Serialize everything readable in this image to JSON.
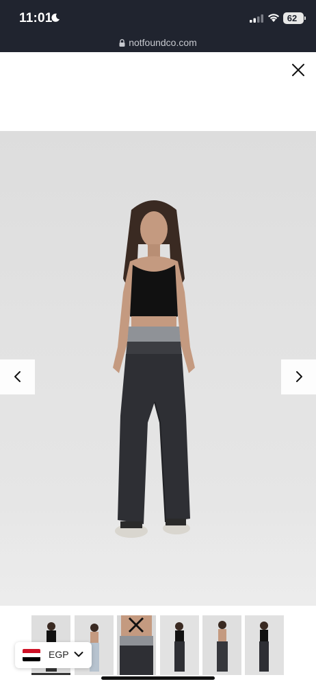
{
  "status_bar": {
    "time": "11:01",
    "battery": "62"
  },
  "browser": {
    "url": "notfoundco.com"
  },
  "gallery": {
    "thumbnail_count": 6
  },
  "currency": {
    "code": "EGP"
  },
  "colors": {
    "status_bg": "#20242f",
    "flag_red": "#ce1126",
    "flag_black": "#000000"
  },
  "icons": {
    "close": "close-icon",
    "prev": "chevron-left-icon",
    "next": "chevron-right-icon",
    "currency_toggle": "chevron-down-icon",
    "lock": "lock-icon",
    "moon": "moon-icon"
  }
}
